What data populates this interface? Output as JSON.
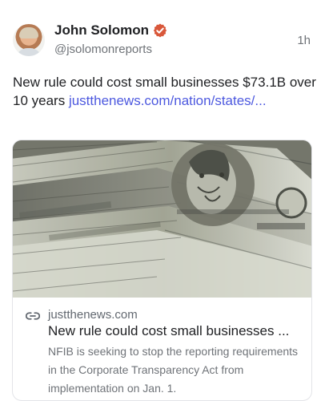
{
  "post": {
    "author_name": "John Solomon",
    "author_handle": "@jsolomonreports",
    "timestamp": "1h",
    "verified_icon": "verified-badge-icon",
    "text": "New rule could cost small businesses $73.1B over 10 years ",
    "link_text": "justthenews.com/nation/states/..."
  },
  "link_card": {
    "domain": "justthenews.com",
    "title": "New rule could cost small businesses ...",
    "description": "NFIB is seeking to stop the reporting requirements in the Corporate Transparency Act from implementation on Jan. 1.",
    "icon": "link-icon"
  },
  "colors": {
    "accent": "#4d59df",
    "verified": "#d9583b",
    "muted_text": "#6f7378",
    "card_border": "#e3e4e8"
  }
}
